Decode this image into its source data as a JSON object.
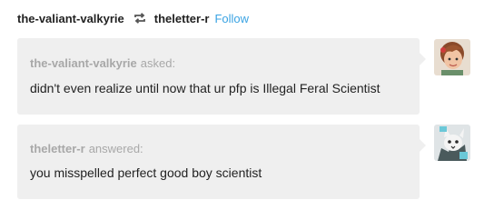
{
  "header": {
    "poster": "the-valiant-valkyrie",
    "reblogged_from": "theletter-r",
    "follow_label": "Follow",
    "reblog_icon": "reblog-icon",
    "accent_color": "#3aa3e3"
  },
  "ask": {
    "name": "the-valiant-valkyrie",
    "verb": "asked:",
    "text": "didn't even realize until now that ur pfp is Illegal Feral Scientist"
  },
  "answer": {
    "name": "theletter-r",
    "verb": "answered:",
    "text": "you misspelled perfect good boy scientist"
  }
}
